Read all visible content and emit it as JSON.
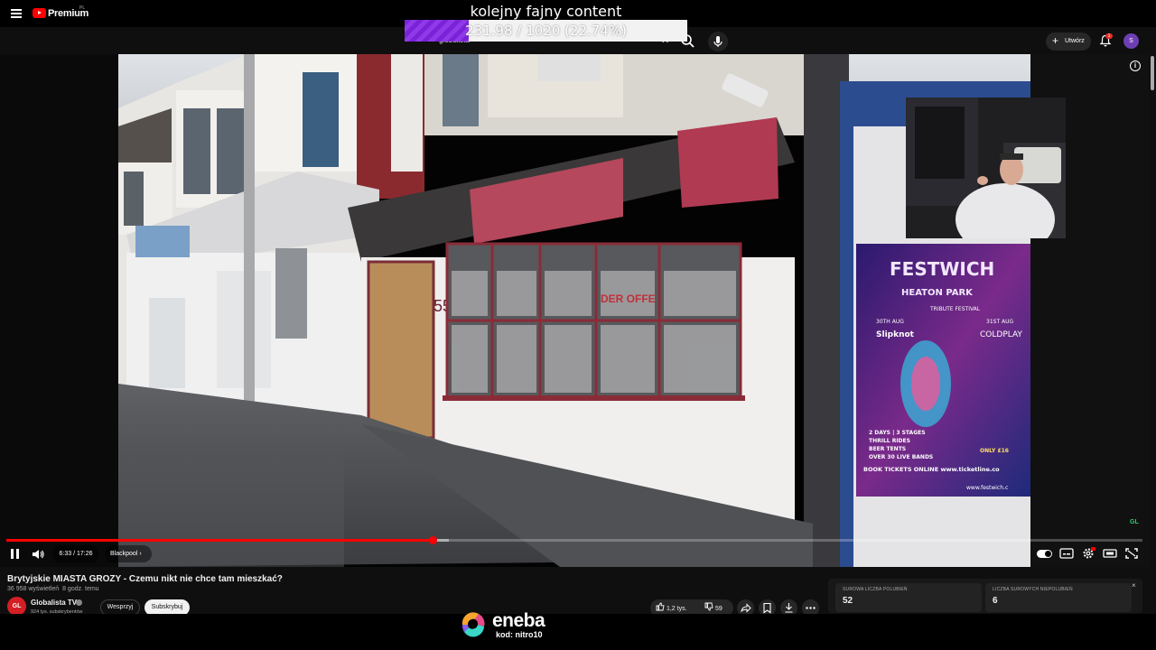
{
  "stream": {
    "title": "kolejny fajny content",
    "goal": {
      "text": "231.98 / 1020 (22.74%)",
      "current": 231.98,
      "target": 1020,
      "percent": 22.74
    }
  },
  "topbar": {
    "brand": "Premium",
    "country": "PL",
    "search_value": "globalista",
    "search_clear": "✕",
    "create_label": "Utwórz",
    "notifications": "1",
    "avatar_letter": "S",
    "icons": [
      "menu-icon",
      "youtube-logo-icon",
      "search-icon",
      "mic-icon",
      "plus-icon",
      "bell-icon"
    ]
  },
  "player": {
    "time": "6:33 / 17:26",
    "chapter": "Blackpool",
    "progress_fraction": 0.3757,
    "buffered_fraction": 0.3897,
    "autoplay_on": true,
    "poster_left": "FESTWICH",
    "poster_sub": "HEATON PARK",
    "poster_tribute": "TRIBUTE FESTIVAL",
    "poster_date1": "30TH AUG",
    "poster_date2": "31ST AUG",
    "poster_band1": "Slipknot",
    "poster_band2": "COLDPLAY",
    "poster_line1": "2 DAYS | 3 STAGES",
    "poster_line2": "THRILL RIDES",
    "poster_line3": "BEER TENTS",
    "poster_line4": "OVER 30 LIVE BANDS",
    "poster_price": "ONLY £16",
    "poster_book": "BOOK TICKETS ONLINE www.ticketline.co",
    "poster_site": "www.festwich.c",
    "shop_number": "55",
    "shop_sign": "DER OFFE"
  },
  "video": {
    "title": "Brytyjskie MIASTA GROZY - Czemu nikt nie chce tam mieszkać?",
    "views": "36 958 wyświetleń",
    "age": "8 godz. temu",
    "channel": "Globalista TV",
    "channel_initials": "GL",
    "subscribers": "924 tys. subskrybentów",
    "join_label": "Wesprzyj",
    "subscribe_label": "Subskrybuj",
    "likes": "1,2 tys.",
    "dislikes": "59"
  },
  "stats": {
    "likes_label": "SUROWA LICZBA POLUBIEŃ",
    "likes_value": "52",
    "dislikes_label": "LICZBA SUROWYCH NIEPOLUBIEŃ",
    "dislikes_value": "6",
    "close": "×"
  },
  "sponsor": {
    "name": "eneba",
    "code": "kod: nitro10"
  },
  "colors": {
    "accent": "#ff0000",
    "goal": "#7a22d8",
    "subscribe_bg": "#f1f1f1"
  }
}
